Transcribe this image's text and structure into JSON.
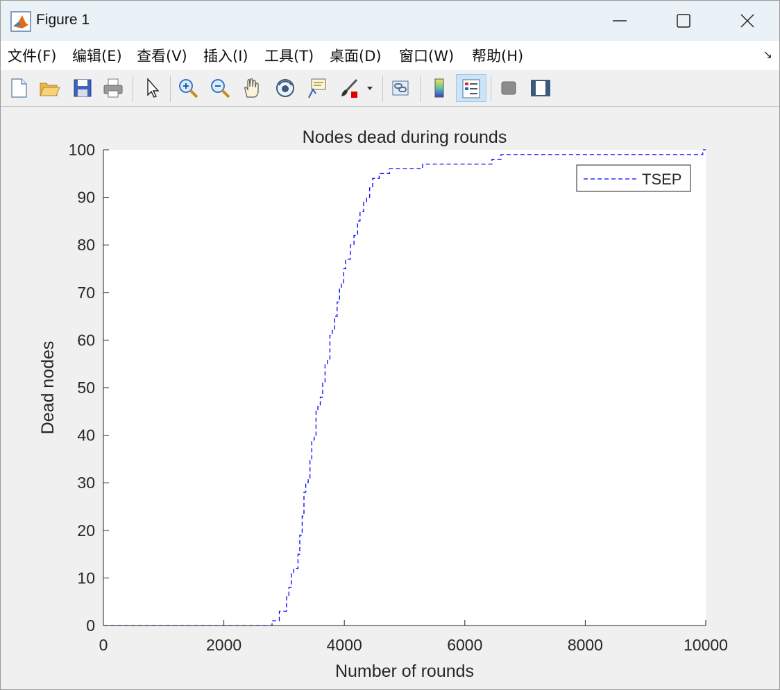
{
  "window": {
    "title": "Figure 1"
  },
  "menu": [
    "文件(F)",
    "编辑(E)",
    "查看(V)",
    "插入(I)",
    "工具(T)",
    "桌面(D)",
    "窗口(W)",
    "帮助(H)"
  ],
  "toolbar": {
    "icons": [
      "new-figure-icon",
      "open-file-icon",
      "save-icon",
      "print-icon",
      "pointer-icon",
      "zoom-in-icon",
      "zoom-out-icon",
      "pan-hand-icon",
      "rotate-3d-icon",
      "data-cursor-icon",
      "brush-icon",
      "brush-dropdown-icon",
      "link-plot-icon",
      "colorbar-icon",
      "legend-icon",
      "hide-plot-tools-icon",
      "show-plot-tools-icon"
    ]
  },
  "chart_data": {
    "type": "line",
    "title": "Nodes dead during rounds",
    "xlabel": "Number of rounds",
    "ylabel": "Dead nodes",
    "xlim": [
      0,
      10000
    ],
    "ylim": [
      0,
      100
    ],
    "xticks": [
      0,
      2000,
      4000,
      6000,
      8000,
      10000
    ],
    "yticks": [
      0,
      10,
      20,
      30,
      40,
      50,
      60,
      70,
      80,
      90,
      100
    ],
    "grid": false,
    "legend_position": "top-right",
    "series": [
      {
        "name": "TSEP",
        "color": "#0000ff",
        "line_style": "dashed",
        "step": true,
        "x": [
          0,
          2750,
          2800,
          2850,
          2920,
          3000,
          3040,
          3080,
          3120,
          3160,
          3200,
          3230,
          3260,
          3300,
          3330,
          3360,
          3400,
          3430,
          3460,
          3500,
          3530,
          3560,
          3600,
          3640,
          3680,
          3720,
          3760,
          3800,
          3840,
          3880,
          3920,
          3950,
          3990,
          4020,
          4060,
          4100,
          4160,
          4220,
          4260,
          4320,
          4370,
          4420,
          4470,
          4520,
          4580,
          4650,
          4750,
          5300,
          6400,
          6450,
          6600,
          9850,
          9950,
          10000
        ],
        "y": [
          0,
          0,
          1,
          1,
          3,
          3,
          6,
          8,
          11,
          12,
          12,
          15,
          19,
          23,
          28,
          30,
          31,
          35,
          39,
          40,
          45,
          46,
          48,
          51,
          55,
          56,
          61,
          62,
          65,
          68,
          71,
          72,
          75,
          77,
          77,
          80,
          82,
          85,
          87,
          89,
          90,
          92,
          94,
          94,
          95,
          95,
          96,
          97,
          97,
          98,
          99,
          99,
          100,
          100
        ]
      }
    ]
  }
}
